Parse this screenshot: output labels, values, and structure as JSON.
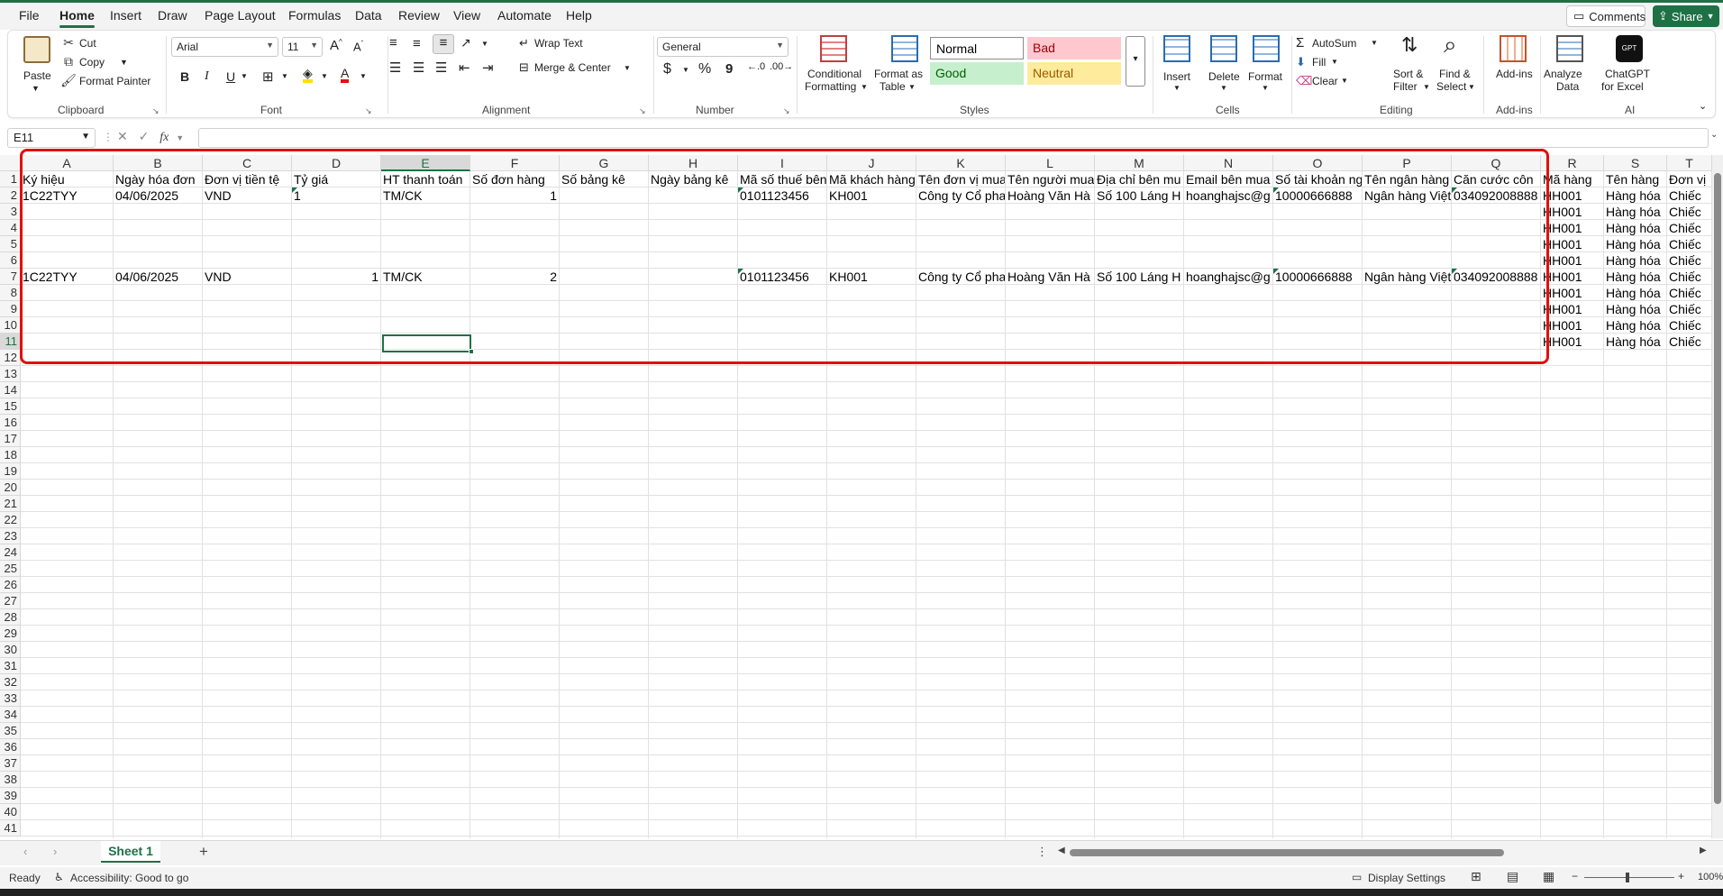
{
  "menu": {
    "tabs": [
      "File",
      "Home",
      "Insert",
      "Draw",
      "Page Layout",
      "Formulas",
      "Data",
      "Review",
      "View",
      "Automate",
      "Help"
    ],
    "comments_label": "Comments",
    "share_label": "Share"
  },
  "ribbon": {
    "clipboard": {
      "paste": "Paste",
      "cut": "Cut",
      "copy": "Copy",
      "format_painter": "Format Painter",
      "label": "Clipboard"
    },
    "font": {
      "name": "Arial",
      "size": "11",
      "label": "Font"
    },
    "alignment": {
      "wrap_text": "Wrap Text",
      "merge_center": "Merge & Center",
      "label": "Alignment"
    },
    "number": {
      "format": "General",
      "currency": "$",
      "percent": "%",
      "comma": "9",
      "label": "Number"
    },
    "styles": {
      "conditional_1": "Conditional",
      "conditional_2": "Formatting",
      "format_table_1": "Format as",
      "format_table_2": "Table",
      "normal": "Normal",
      "bad": "Bad",
      "good": "Good",
      "neutral": "Neutral",
      "label": "Styles"
    },
    "cells": {
      "insert": "Insert",
      "delete": "Delete",
      "format": "Format",
      "label": "Cells"
    },
    "editing": {
      "autosum": "AutoSum",
      "fill": "Fill",
      "clear": "Clear",
      "sort_1": "Sort &",
      "sort_2": "Filter",
      "find_1": "Find &",
      "find_2": "Select",
      "label": "Editing"
    },
    "addins": {
      "addins": "Add-ins",
      "label": "Add-ins"
    },
    "ai": {
      "analyze_1": "Analyze",
      "analyze_2": "Data",
      "chatgpt_1": "ChatGPT",
      "chatgpt_2": "for Excel",
      "gpt_logo": "GPT",
      "label": "AI"
    }
  },
  "formula_bar": {
    "name_box": "E11",
    "fx": "fx",
    "value": ""
  },
  "sheet": {
    "columns": [
      "A",
      "B",
      "C",
      "D",
      "E",
      "F",
      "G",
      "H",
      "I",
      "J",
      "K",
      "L",
      "M",
      "N",
      "O",
      "P",
      "Q",
      "R",
      "S",
      "T"
    ],
    "selected_column": "E",
    "selected_row": "11",
    "row_numbers": [
      "1",
      "2",
      "3",
      "4",
      "5",
      "6",
      "7",
      "8",
      "9",
      "10",
      "11",
      "12",
      "13",
      "14",
      "15",
      "16",
      "17",
      "18",
      "19",
      "20",
      "21",
      "22",
      "23",
      "24",
      "25",
      "26",
      "27",
      "28",
      "29",
      "30",
      "31",
      "32",
      "33",
      "34",
      "35",
      "36",
      "37",
      "38",
      "39",
      "40",
      "41"
    ],
    "headers": [
      "Ký hiệu",
      "Ngày hóa đơn",
      "Đơn vị tiền tệ",
      "Tỷ giá",
      "HT thanh toán",
      "Số đơn hàng",
      "Số bảng kê",
      "Ngày bảng kê",
      "Mã số thuế bên",
      "Mã khách hàng",
      "Tên đơn vị mua",
      "Tên người mua",
      "Địa chỉ bên mu",
      "Email bên mua",
      "Số tài khoản ng",
      "Tên ngân hàng",
      "Căn cước côn",
      "Mã hàng",
      "Tên hàng",
      "Đơn vị"
    ],
    "row2": [
      "1C22TYY",
      "04/06/2025",
      "VND",
      "1",
      "TM/CK",
      "1",
      "",
      "",
      "0101123456",
      "KH001",
      "Công ty Cổ pha",
      "Hoàng Văn Hà",
      "Số 100 Láng H",
      "hoanghajsc@g",
      "10000666888",
      "Ngân hàng Việt",
      "034092008888",
      "HH001",
      "Hàng hóa",
      "Chiếc"
    ],
    "row7": [
      "1C22TYY",
      "04/06/2025",
      "VND",
      "1",
      "TM/CK",
      "2",
      "",
      "",
      "0101123456",
      "KH001",
      "Công ty Cổ pha",
      "Hoàng Văn Hà",
      "Số 100 Láng H",
      "hoanghajsc@g",
      "10000666888",
      "Ngân hàng Việt",
      "034092008888",
      "HH001",
      "Hàng hóa",
      "Chiếc"
    ],
    "item_code": "HH001",
    "item_name": "Hàng hóa",
    "item_unit": "Chiếc"
  },
  "sheet_tabs": {
    "active": "Sheet 1",
    "add": "+"
  },
  "status": {
    "ready": "Ready",
    "accessibility": "Accessibility: Good to go",
    "display_settings": "Display Settings",
    "zoom": "100%"
  },
  "colors": {
    "accent": "#1e7145",
    "highlight": "#e01010",
    "bad_bg": "#ffc7ce",
    "bad_fg": "#9c0006",
    "good_bg": "#c6efce",
    "good_fg": "#006100",
    "neutral_bg": "#ffeb9c",
    "neutral_fg": "#9c5700"
  }
}
